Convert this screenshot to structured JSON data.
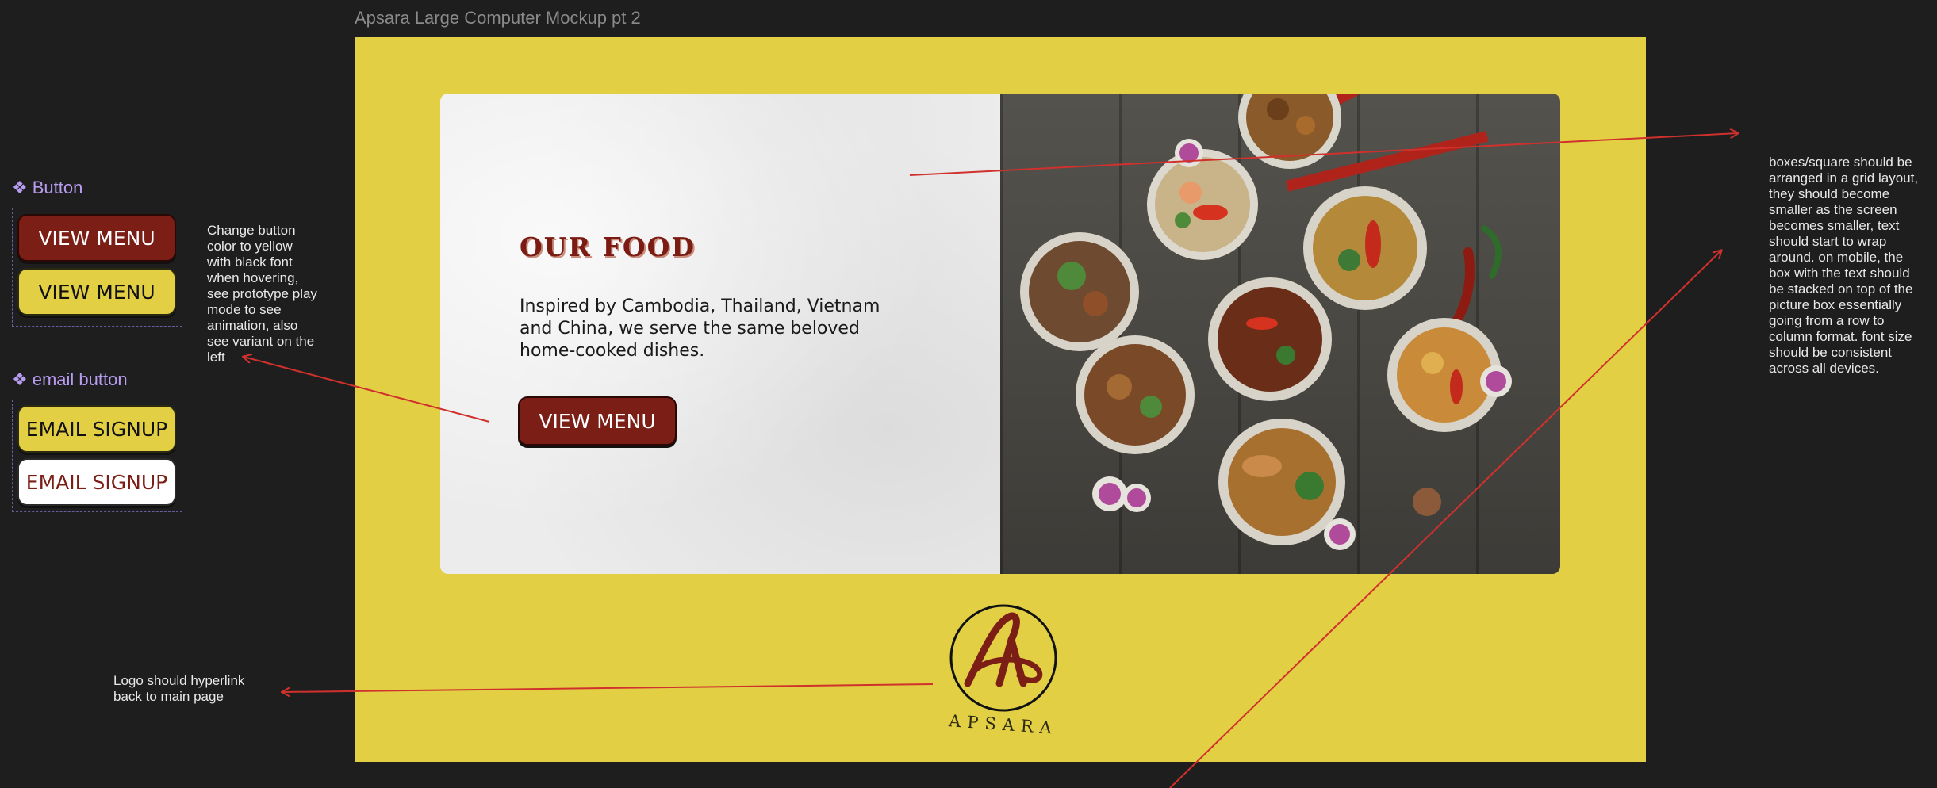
{
  "frame_title": "Apsara Large Computer Mockup pt 2",
  "card": {
    "heading": "OUR FOOD",
    "description": "Inspired by Cambodia, Thailand, Vietnam and China, we serve the same beloved home-cooked dishes.",
    "button_label": "VIEW MENU"
  },
  "logo": {
    "wordmark": "APSARA",
    "letter": "A"
  },
  "components": {
    "button": {
      "label": "Button",
      "variants": [
        "VIEW MENU",
        "VIEW MENU"
      ]
    },
    "email_button": {
      "label": "email button",
      "variants": [
        "EMAIL SIGNUP",
        "EMAIL SIGNUP"
      ]
    }
  },
  "notes": {
    "button_hover": [
      "Change button",
      "color to yellow",
      "with black font",
      "when hovering,",
      "see prototype play",
      "mode to see",
      "animation, also",
      "see variant on the",
      "left"
    ],
    "logo_link": [
      "Logo should hyperlink",
      "back to main page"
    ],
    "grid_layout": [
      "boxes/square should be",
      "arranged in a grid layout,",
      "they should become",
      "smaller as the screen",
      "becomes smaller, text",
      "should start to wrap",
      "around. on mobile, the",
      "box with the text should",
      "be stacked on top of the",
      "picture box essentially",
      "going from a row to",
      "column format. font size",
      "should be consistent",
      "across all devices."
    ]
  },
  "colors": {
    "canvas": "#1e1e1e",
    "frame_yellow": "#e2cf44",
    "brand_red": "#7b1e16",
    "annotation_arrow": "#d0312d",
    "component_label": "#b79cf0"
  },
  "icons": [
    "component-diamond-icon",
    "apsara-logo-icon"
  ]
}
